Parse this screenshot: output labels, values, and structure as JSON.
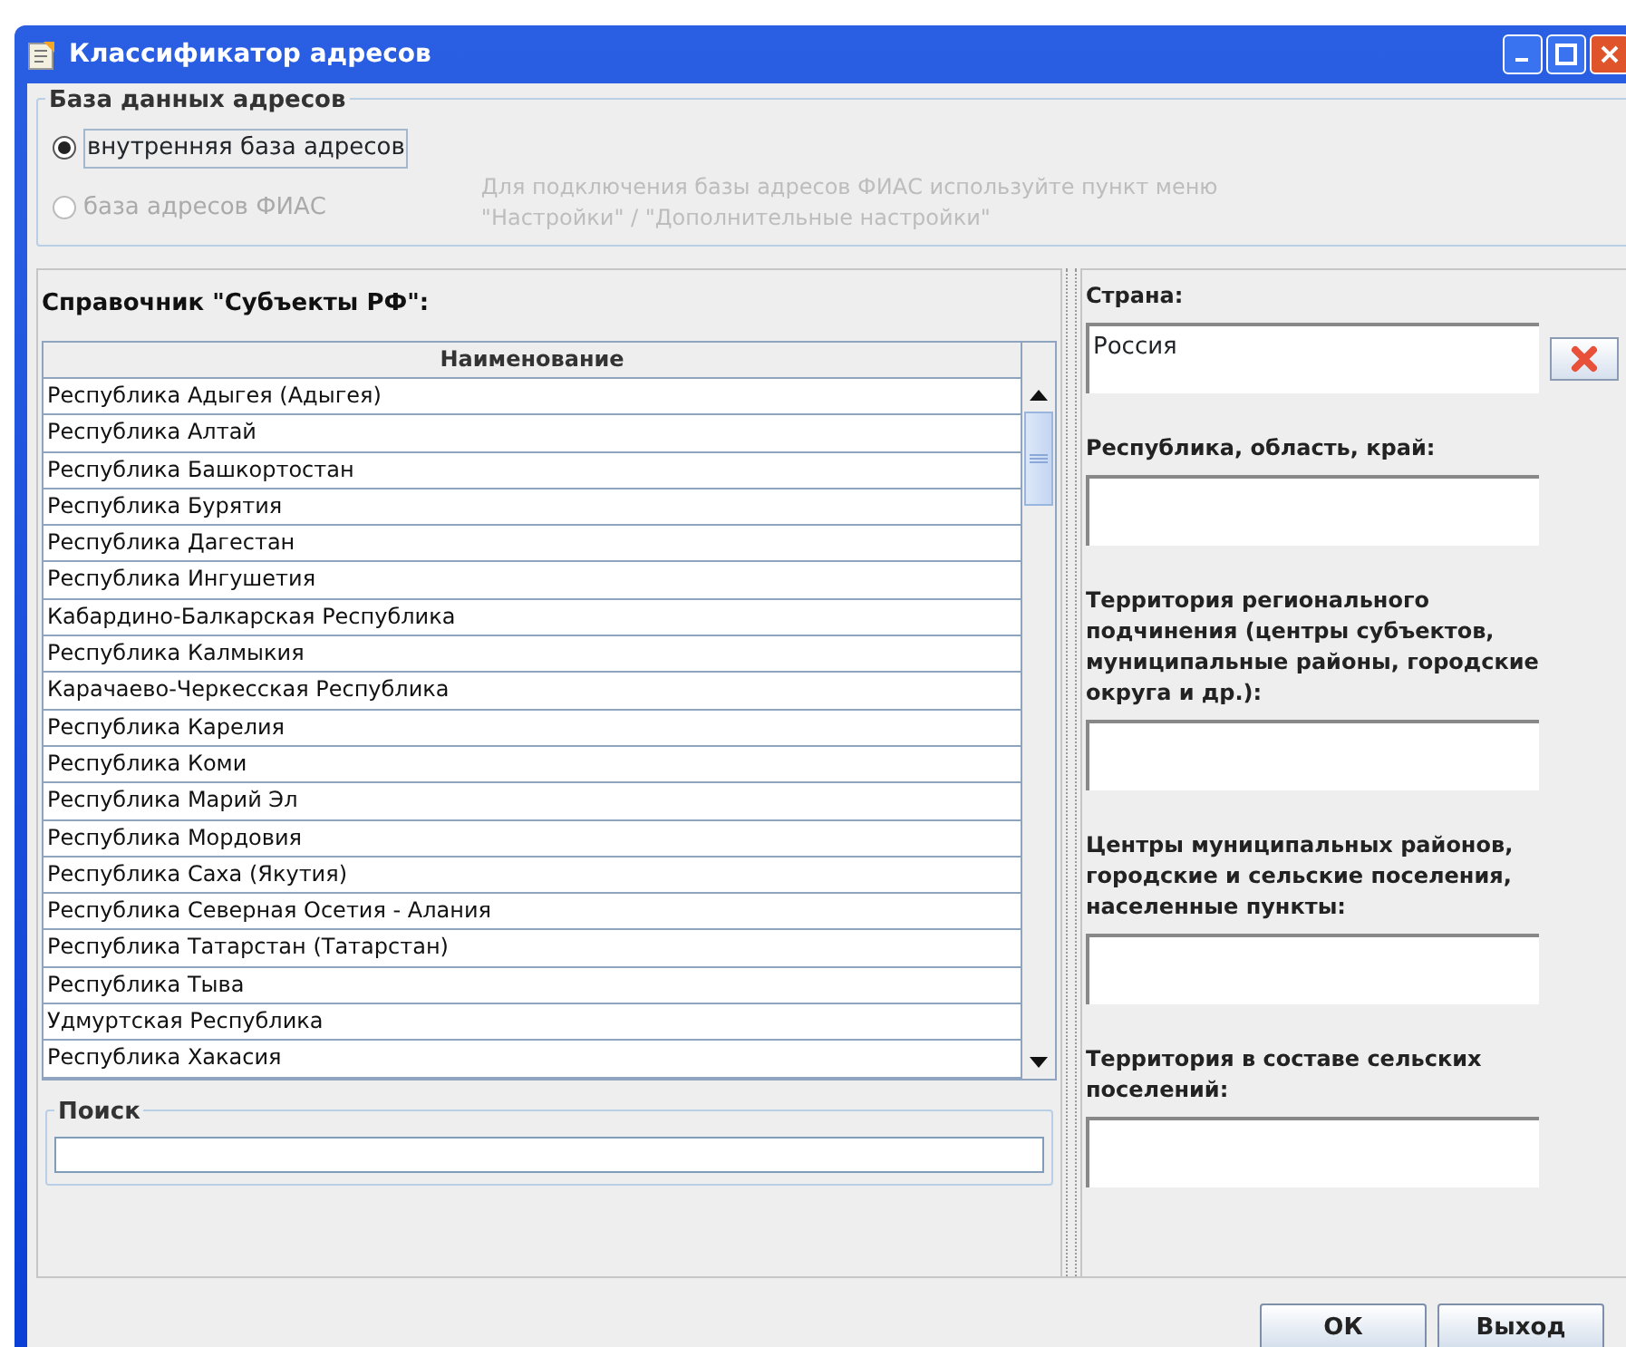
{
  "window": {
    "title": "Классификатор адресов"
  },
  "database": {
    "title": "База данных адресов",
    "options": [
      {
        "label": "внутренняя база адресов",
        "selected": true,
        "disabled": false
      },
      {
        "label": "база адресов ФИАС",
        "selected": false,
        "disabled": true
      }
    ],
    "hint_lines": [
      "Для подключения базы адресов ФИАС используйте пункт меню",
      "\"Настройки\" / \"Дополнительные настройки\""
    ]
  },
  "reference": {
    "title": "Справочник \"Субъекты РФ\":",
    "columns": [
      "Наименование"
    ],
    "rows": [
      "Республика Адыгея (Адыгея)",
      "Республика Алтай",
      "Республика Башкортостан",
      "Республика Бурятия",
      "Республика Дагестан",
      "Республика Ингушетия",
      "Кабардино-Балкарская Республика",
      "Республика Калмыкия",
      "Карачаево-Черкесская Республика",
      "Республика Карелия",
      "Республика Коми",
      "Республика Марий Эл",
      "Республика Мордовия",
      "Республика Саха (Якутия)",
      "Республика Северная Осетия - Алания",
      "Республика Татарстан (Татарстан)",
      "Республика Тыва",
      "Удмуртская Республика",
      "Республика Хакасия"
    ]
  },
  "search": {
    "title": "Поиск"
  },
  "address_fields": [
    {
      "label": "Страна:",
      "value": "Россия",
      "clearable": true
    },
    {
      "label": "Республика, область, край:",
      "clearable": false
    },
    {
      "label": "Территория регионального подчинения (центры субъектов, муниципальные районы, городские округа и др.):",
      "clearable": false
    },
    {
      "label": "Центры муниципальных районов, городские и сельские поселения, населенные пункты:",
      "clearable": false
    },
    {
      "label": "Территория в составе сельских поселений:",
      "clearable": false
    }
  ],
  "buttons": [
    "ОК",
    "Выход"
  ]
}
